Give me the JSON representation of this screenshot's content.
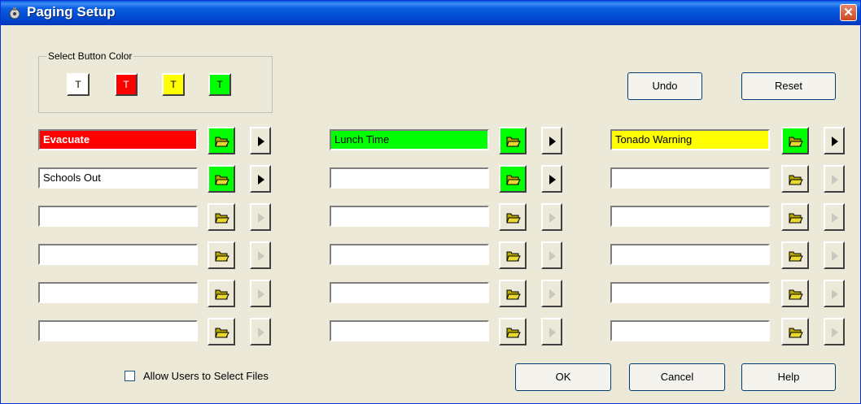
{
  "window": {
    "title": "Paging Setup",
    "close_glyph": "✕"
  },
  "color_group": {
    "label": "Select Button Color",
    "swatches": [
      {
        "label": "T",
        "color": "#ffffff"
      },
      {
        "label": "T",
        "color": "#ff0000"
      },
      {
        "label": "T",
        "color": "#ffff00"
      },
      {
        "label": "T",
        "color": "#00ff00"
      }
    ]
  },
  "buttons": {
    "undo": "Undo",
    "reset": "Reset",
    "ok": "OK",
    "cancel": "Cancel",
    "help": "Help"
  },
  "columns": [
    {
      "rows": [
        {
          "text": "Evacuate",
          "color": "#ff0000",
          "enabled": true
        },
        {
          "text": "Schools Out",
          "color": "#ffffff",
          "enabled": true
        },
        {
          "text": "",
          "color": "#ffffff",
          "enabled": false
        },
        {
          "text": "",
          "color": "#ffffff",
          "enabled": false
        },
        {
          "text": "",
          "color": "#ffffff",
          "enabled": false
        },
        {
          "text": "",
          "color": "#ffffff",
          "enabled": false
        }
      ]
    },
    {
      "rows": [
        {
          "text": "Lunch Time",
          "color": "#00ff00",
          "enabled": true
        },
        {
          "text": "",
          "color": "#ffffff",
          "enabled": true
        },
        {
          "text": "",
          "color": "#ffffff",
          "enabled": false
        },
        {
          "text": "",
          "color": "#ffffff",
          "enabled": false
        },
        {
          "text": "",
          "color": "#ffffff",
          "enabled": false
        },
        {
          "text": "",
          "color": "#ffffff",
          "enabled": false
        }
      ]
    },
    {
      "rows": [
        {
          "text": "Tonado Warning",
          "color": "#ffff00",
          "enabled": true
        },
        {
          "text": "",
          "color": "#ffffff",
          "enabled": false
        },
        {
          "text": "",
          "color": "#ffffff",
          "enabled": false
        },
        {
          "text": "",
          "color": "#ffffff",
          "enabled": false
        },
        {
          "text": "",
          "color": "#ffffff",
          "enabled": false
        },
        {
          "text": "",
          "color": "#ffffff",
          "enabled": false
        }
      ]
    }
  ],
  "allow_files": {
    "label": "Allow Users to Select Files",
    "checked": false
  },
  "icons": {
    "folder": "folder-open-icon",
    "play": "play-icon",
    "app": "paging-app-icon"
  }
}
